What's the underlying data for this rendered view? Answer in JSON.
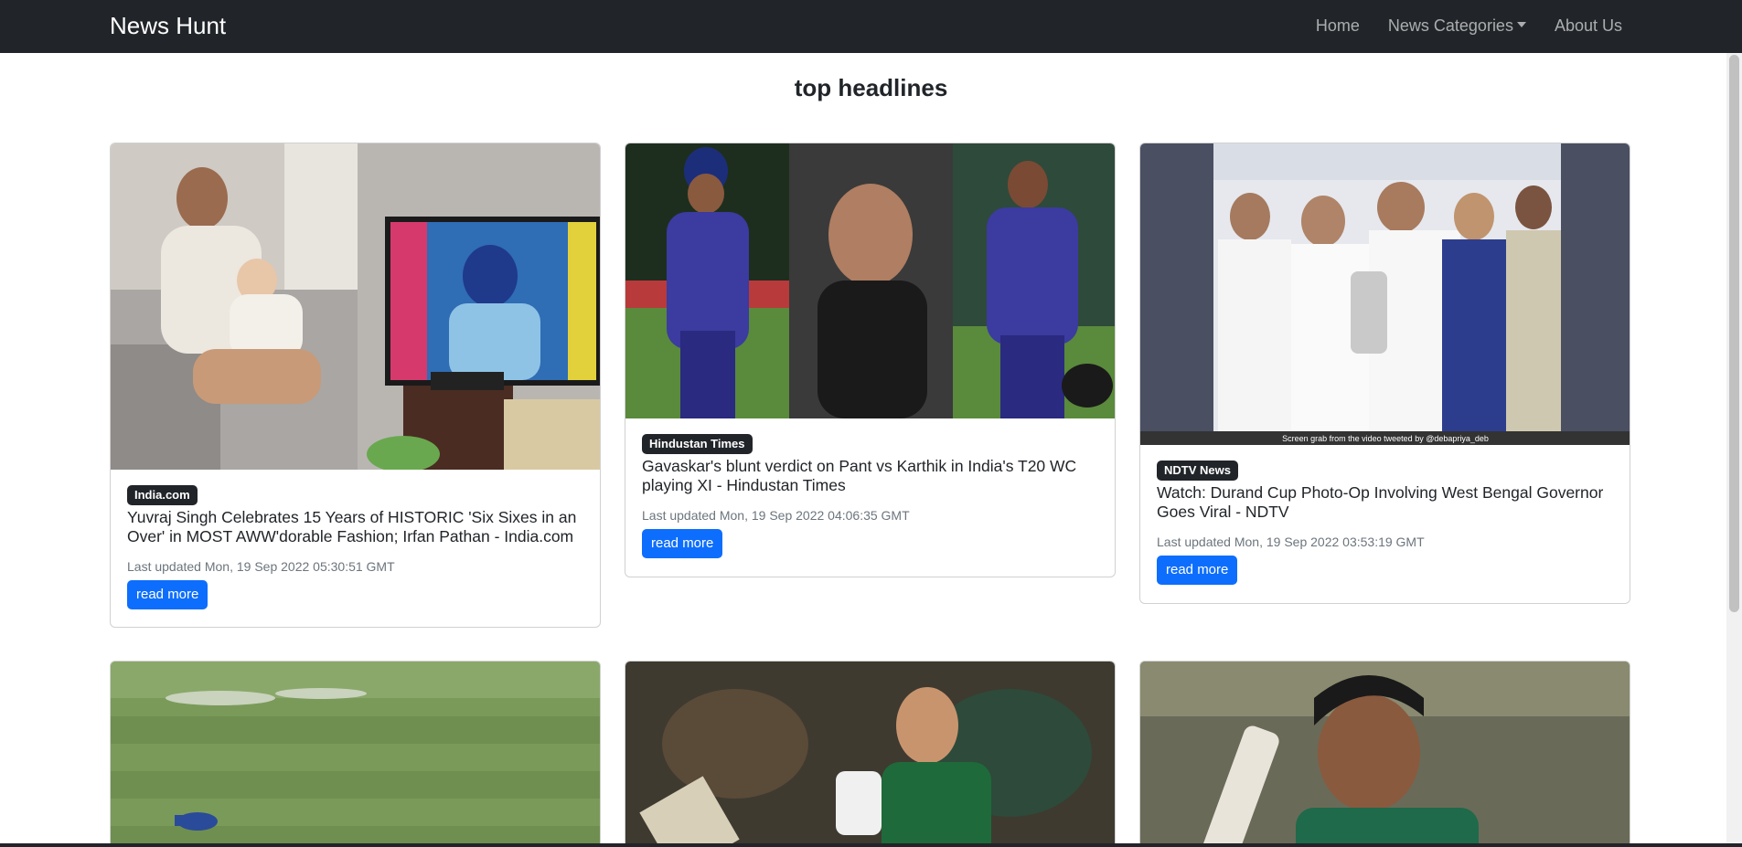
{
  "navbar": {
    "brand": "News Hunt",
    "links": [
      {
        "label": "Home"
      },
      {
        "label": "News Categories"
      },
      {
        "label": "About Us"
      }
    ]
  },
  "page_title": "top headlines",
  "cards": [
    {
      "source": "India.com",
      "title": "Yuvraj Singh Celebrates 15 Years of HISTORIC 'Six Sixes in an Over' in MOST AWW'dorable Fashion; Irfan Pathan - India.com",
      "updated": "Last updated Mon, 19 Sep 2022 05:30:51 GMT",
      "button": "read more"
    },
    {
      "source": "Hindustan Times",
      "title": "Gavaskar's blunt verdict on Pant vs Karthik in India's T20 WC playing XI - Hindustan Times",
      "updated": "Last updated Mon, 19 Sep 2022 04:06:35 GMT",
      "button": "read more"
    },
    {
      "source": "NDTV News",
      "title": "Watch: Durand Cup Photo-Op Involving West Bengal Governor Goes Viral - NDTV",
      "updated": "Last updated Mon, 19 Sep 2022 03:53:19 GMT",
      "button": "read more",
      "image_caption": "Screen grab from the video tweeted by @debapriya_deb"
    }
  ],
  "colors": {
    "navbar": "#212529",
    "primary": "#0d6efd",
    "badge": "#212529"
  }
}
